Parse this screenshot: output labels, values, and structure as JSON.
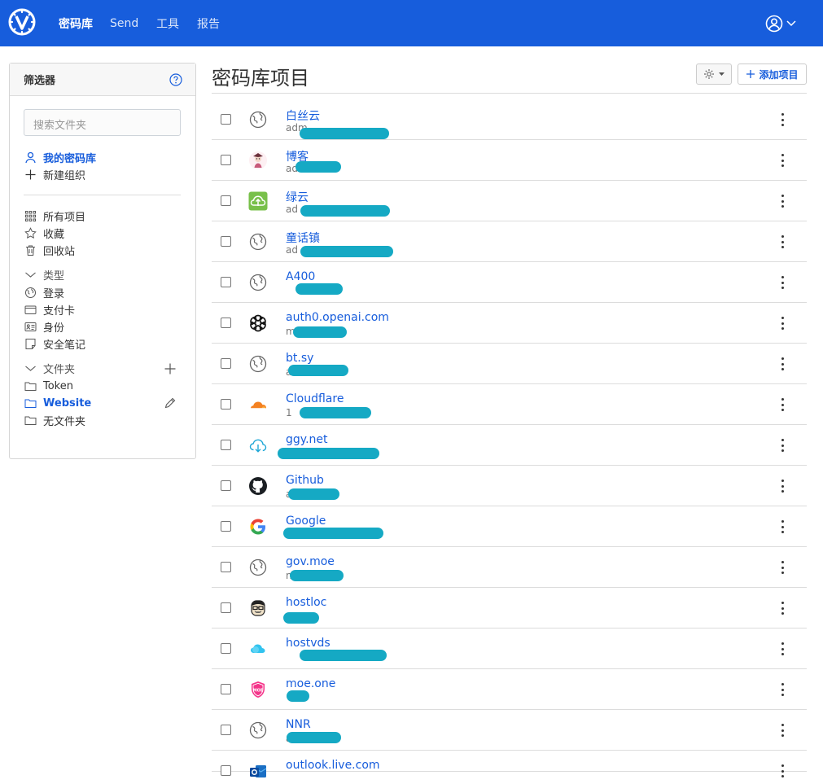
{
  "header": {
    "nav": [
      "密码库",
      "Send",
      "工具",
      "报告"
    ],
    "active_nav": "密码库"
  },
  "sidebar": {
    "title": "筛选器",
    "search_placeholder": "搜索文件夹",
    "vault": {
      "my_vault": "我的密码库",
      "new_org": "新建组织"
    },
    "items": [
      "所有项目",
      "收藏",
      "回收站"
    ],
    "types_header": "类型",
    "types": [
      "登录",
      "支付卡",
      "身份",
      "安全笔记"
    ],
    "folders_header": "文件夹",
    "folders": [
      "Token",
      "Website",
      "无文件夹"
    ],
    "selected_folder": "Website"
  },
  "main": {
    "title": "密码库项目",
    "add_button": "添加项目",
    "items": [
      {
        "name": "白丝云",
        "sub": "adm",
        "icon": "globe-icon"
      },
      {
        "name": "博客",
        "sub": "ad",
        "icon": "avatar-icon"
      },
      {
        "name": "绿云",
        "sub": "ad",
        "icon": "green-cloud-icon"
      },
      {
        "name": "童话镇",
        "sub": "ad",
        "icon": "globe-icon"
      },
      {
        "name": "A400",
        "sub": "",
        "icon": "globe-icon"
      },
      {
        "name": "auth0.openai.com",
        "sub": "m",
        "icon": "openai-icon"
      },
      {
        "name": "bt.sy",
        "sub": "a",
        "icon": "globe-icon"
      },
      {
        "name": "Cloudflare",
        "sub": "1",
        "icon": "cloudflare-icon"
      },
      {
        "name": "ggy.net",
        "sub": "",
        "icon": "cloud-download-icon"
      },
      {
        "name": "Github",
        "sub": "a",
        "icon": "github-icon"
      },
      {
        "name": "Google",
        "sub": "",
        "icon": "google-icon"
      },
      {
        "name": "gov.moe",
        "sub": "n",
        "icon": "globe-icon"
      },
      {
        "name": "hostloc",
        "sub": "",
        "icon": "hostloc-icon"
      },
      {
        "name": "hostvds",
        "sub": "",
        "icon": "hostvds-cloud-icon"
      },
      {
        "name": "moe.one",
        "sub": "",
        "icon": "moe-shield-icon"
      },
      {
        "name": "NNR",
        "sub": "a",
        "icon": "globe-icon"
      },
      {
        "name": "outlook.live.com",
        "sub": "",
        "icon": "outlook-icon"
      }
    ]
  },
  "colors": {
    "brand": "#175ddc",
    "redaction": "#15a9c4"
  }
}
